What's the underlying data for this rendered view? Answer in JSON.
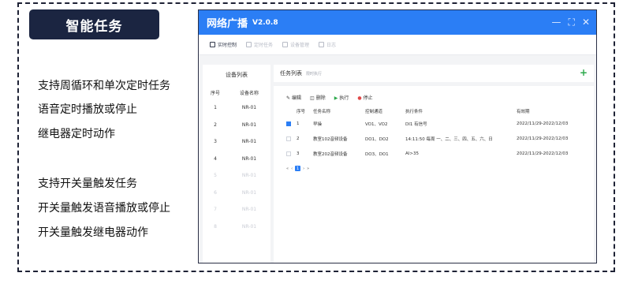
{
  "badge": "智能任务",
  "features": [
    "支持周循环和单次定时任务",
    "语音定时播放或停止",
    "继电器定时动作",
    "支持开关量触发任务",
    "开关量触发语音播放或停止",
    "开关量触发继电器动作"
  ],
  "window": {
    "title": "网络广播",
    "version": "V2.0.8",
    "controls": {
      "minimize": "—",
      "maximize": "⛶",
      "close": "✕"
    },
    "toolbar": [
      "实时控制",
      "定时任务",
      "设备管理",
      "日志"
    ]
  },
  "device_list": {
    "title": "设备列表",
    "headers": [
      "序号",
      "设备名称"
    ],
    "rows": [
      {
        "no": "1",
        "name": "NR-01"
      },
      {
        "no": "2",
        "name": "NR-01"
      },
      {
        "no": "3",
        "name": "NR-01"
      },
      {
        "no": "4",
        "name": "NR-01"
      },
      {
        "no": "5",
        "name": "NR-01"
      },
      {
        "no": "6",
        "name": "NR-01"
      },
      {
        "no": "7",
        "name": "NR-01"
      },
      {
        "no": "8",
        "name": "NR-01"
      }
    ]
  },
  "task_list": {
    "title": "任务列表",
    "subtitle": "限时执行",
    "add_icon": "+",
    "actions": [
      "编辑",
      "删除",
      "执行",
      "停止"
    ],
    "headers": [
      "序号",
      "任务名称",
      "控制通道",
      "执行条件",
      "有效期"
    ],
    "rows": [
      {
        "no": "1",
        "name": "早操",
        "channel": "VO1、VO2",
        "condition": "DI1 有信号",
        "period": "2022/11/29-2022/12/03"
      },
      {
        "no": "2",
        "name": "教室102音频设备",
        "channel": "DO1、DO2",
        "condition": "14:11:50 每周 一、二、三、四、五、六、日",
        "period": "2022/11/29-2022/12/03"
      },
      {
        "no": "3",
        "name": "教室202音频设备",
        "channel": "DO3、DO1",
        "condition": "AI>35",
        "period": "2022/11/29-2022/12/03"
      }
    ],
    "pager": {
      "first": "«",
      "prev": "‹",
      "current": "1",
      "next": "›",
      "last": "»"
    }
  },
  "colors": {
    "accent": "#2b7ef5",
    "badge_bg": "#1b2541",
    "add": "#2ca94b",
    "stop": "#e04848"
  }
}
